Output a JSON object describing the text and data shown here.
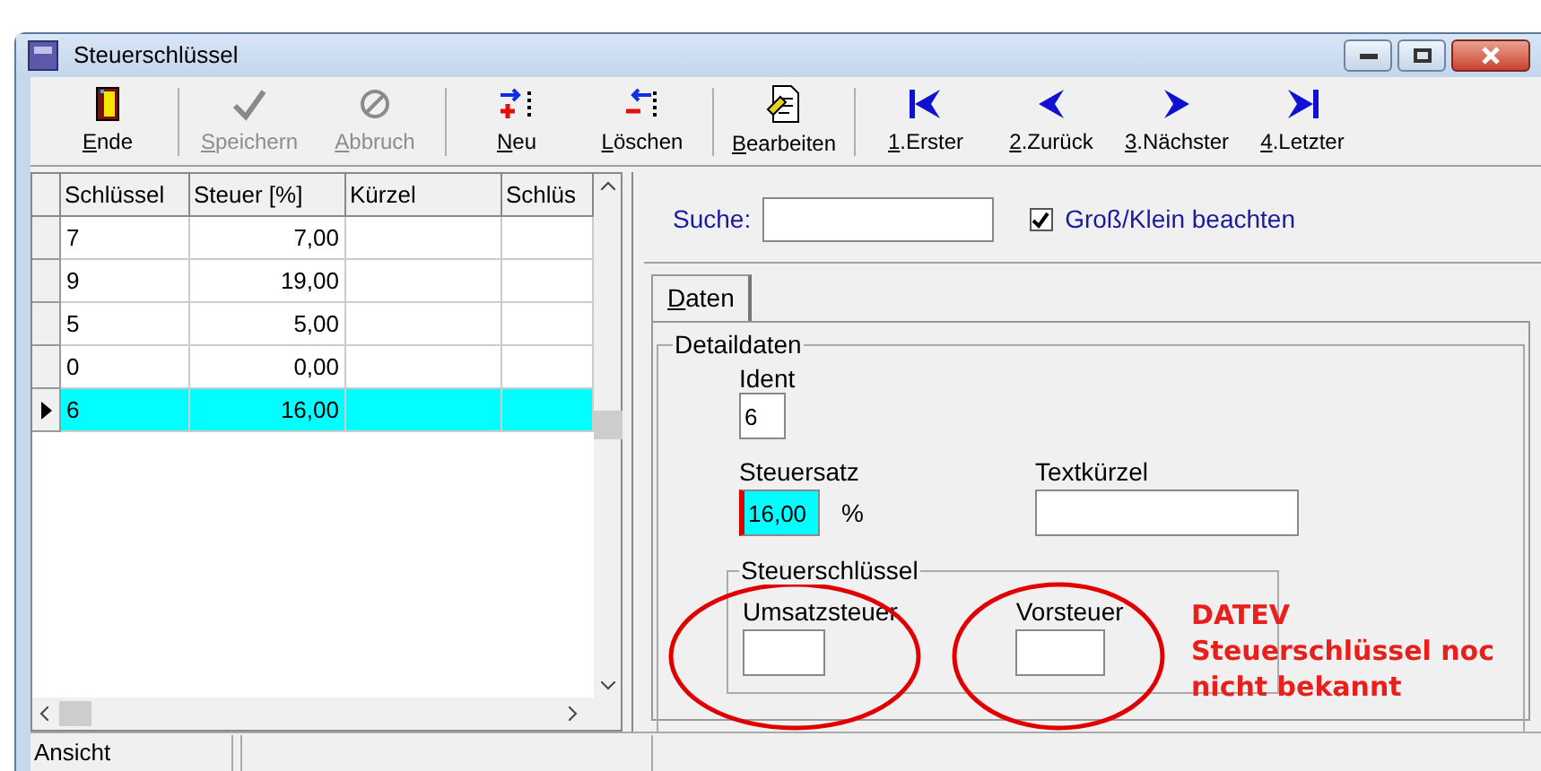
{
  "window": {
    "title": "Steuerschlüssel"
  },
  "toolbar": {
    "groups": [
      [
        {
          "kind": "exit",
          "label": "Ende",
          "disabled": false
        }
      ],
      [
        {
          "kind": "save",
          "label": "Speichern",
          "disabled": true
        },
        {
          "kind": "cancel",
          "label": "Abbruch",
          "disabled": true
        }
      ],
      [
        {
          "kind": "new",
          "label": "Neu",
          "disabled": false
        },
        {
          "kind": "delete",
          "label": "Löschen",
          "disabled": false
        }
      ],
      [
        {
          "kind": "edit",
          "label": "Bearbeiten",
          "disabled": false
        }
      ],
      [
        {
          "kind": "first",
          "label": "1.Erster",
          "disabled": false
        },
        {
          "kind": "previous",
          "label": "2.Zurück",
          "disabled": false
        },
        {
          "kind": "next",
          "label": "3.Nächster",
          "disabled": false
        },
        {
          "kind": "last",
          "label": "4.Letzter",
          "disabled": false
        }
      ]
    ]
  },
  "table": {
    "columns": [
      "Schlüssel",
      "Steuer [%]",
      "Kürzel",
      "Schlüs"
    ],
    "rows": [
      {
        "cells": [
          "7",
          "7,00",
          "",
          ""
        ],
        "selected": false
      },
      {
        "cells": [
          "9",
          "19,00",
          "",
          ""
        ],
        "selected": false
      },
      {
        "cells": [
          "5",
          "5,00",
          "",
          ""
        ],
        "selected": false
      },
      {
        "cells": [
          "0",
          "0,00",
          "",
          ""
        ],
        "selected": false
      },
      {
        "cells": [
          "6",
          "16,00",
          "",
          ""
        ],
        "selected": true
      }
    ]
  },
  "search": {
    "label": "Suche:",
    "checkbox": {
      "label": "Groß/Klein beachten",
      "checked": true
    }
  },
  "tabs": [
    {
      "label": "Daten",
      "selected": true
    }
  ],
  "details": {
    "title": "Detaildaten",
    "ident": {
      "label": "Ident",
      "value": "6"
    },
    "rate": {
      "label": "Steuersatz",
      "value": "16,00",
      "unit": "%"
    },
    "short_text": {
      "label": "Textkürzel"
    },
    "tax_key": {
      "title": "Steuerschlüssel",
      "sales_tax": {
        "label": "Umsatzsteuer"
      },
      "input_tax": {
        "label": "Vorsteuer"
      }
    }
  },
  "annotation": {
    "lines": [
      "DATEV",
      "Steuerschlüssel noc",
      "nicht bekannt"
    ]
  },
  "status_bar": [
    "Ansicht"
  ]
}
